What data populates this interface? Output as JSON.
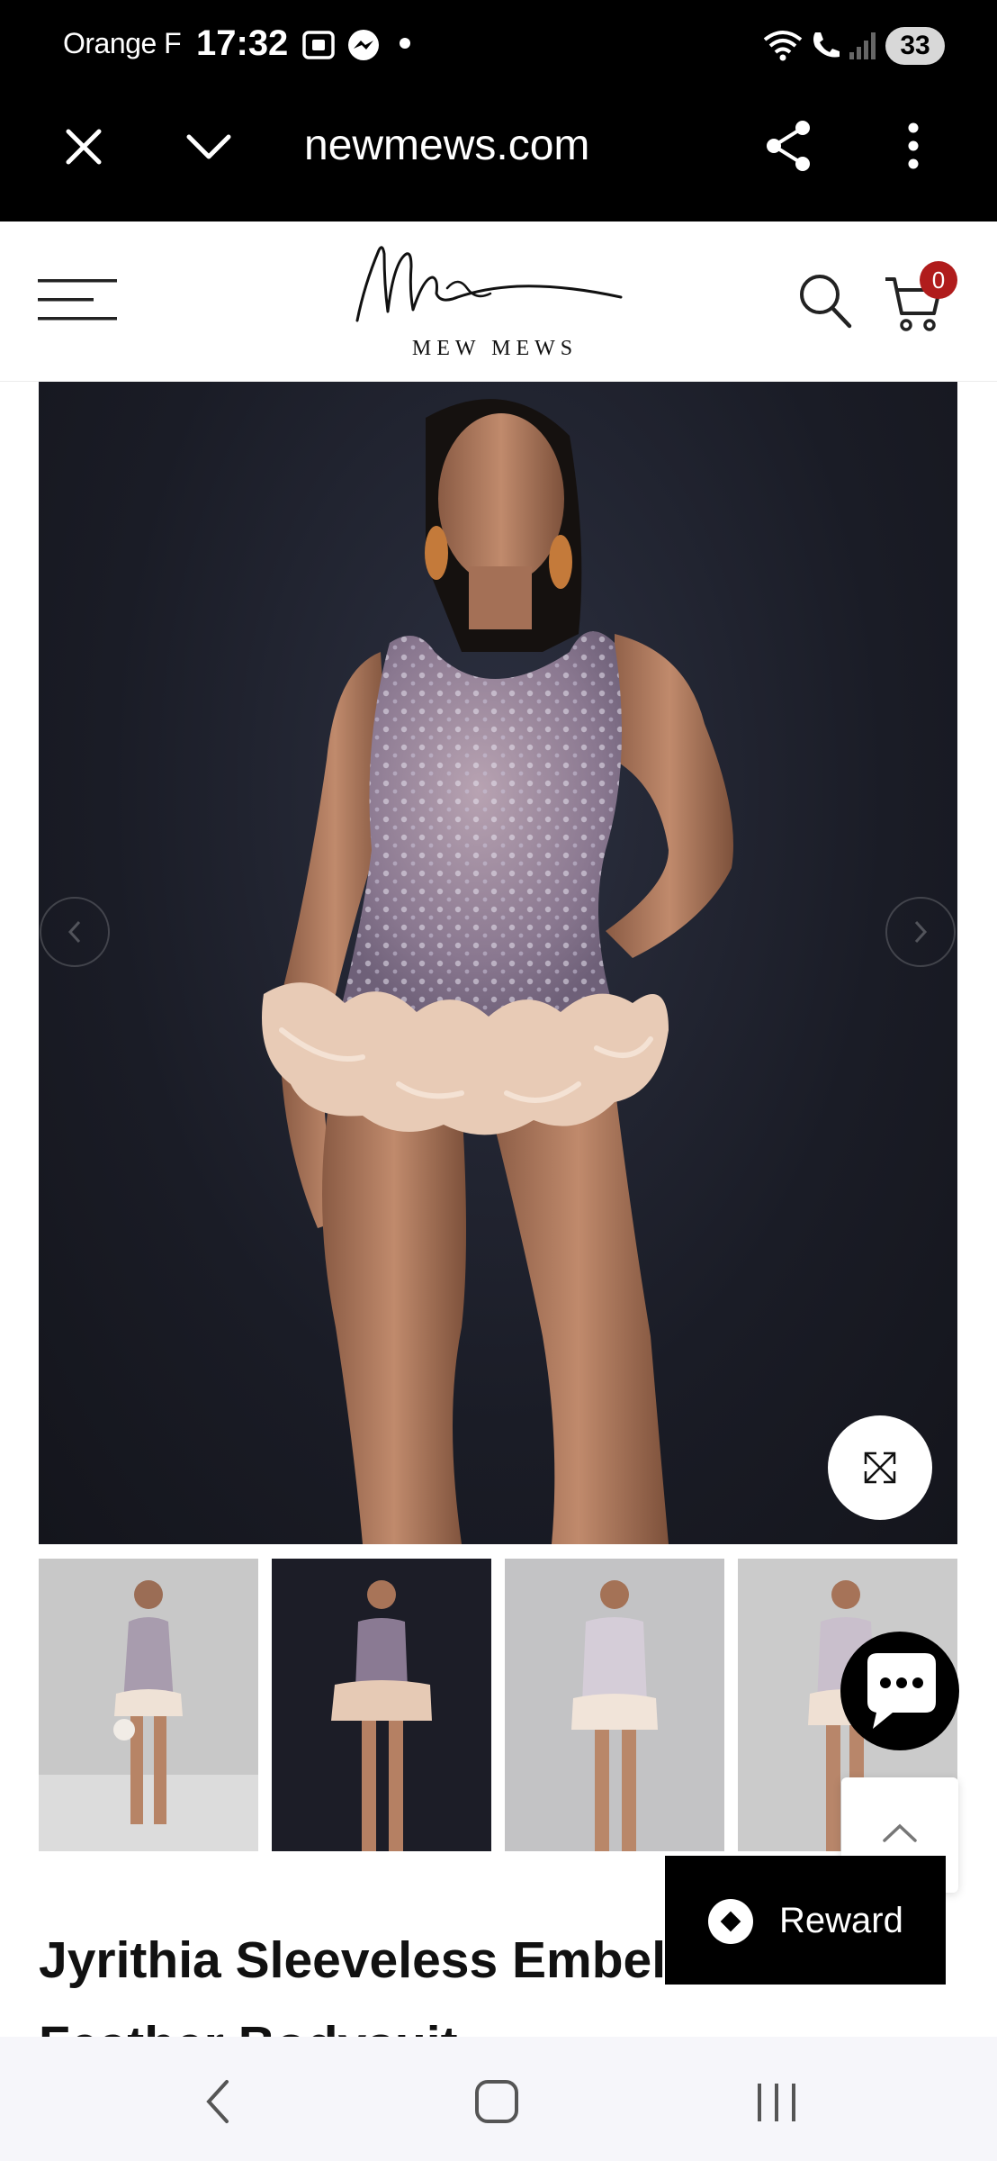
{
  "status_bar": {
    "carrier": "Orange F",
    "time": "17:32",
    "battery": "33"
  },
  "browser": {
    "url": "mewmews.com",
    "url_display": "newmews.com"
  },
  "site": {
    "brand": "MEW MEWS",
    "cart_count": "0"
  },
  "gallery": {
    "thumbnails": [
      {
        "label": "view-1",
        "background": "#c9c9c9"
      },
      {
        "label": "view-2",
        "background": "#1c1d27"
      },
      {
        "label": "view-3",
        "background": "#c2c2c4"
      },
      {
        "label": "view-4",
        "background": "#cacaca"
      }
    ]
  },
  "actions": {
    "reward_label": "Reward"
  },
  "product": {
    "title": "Jyrithia Sleeveless Embellished Feather Bodysuit"
  },
  "colors": {
    "accent_badge": "#b01c1c",
    "dark": "#000000"
  }
}
